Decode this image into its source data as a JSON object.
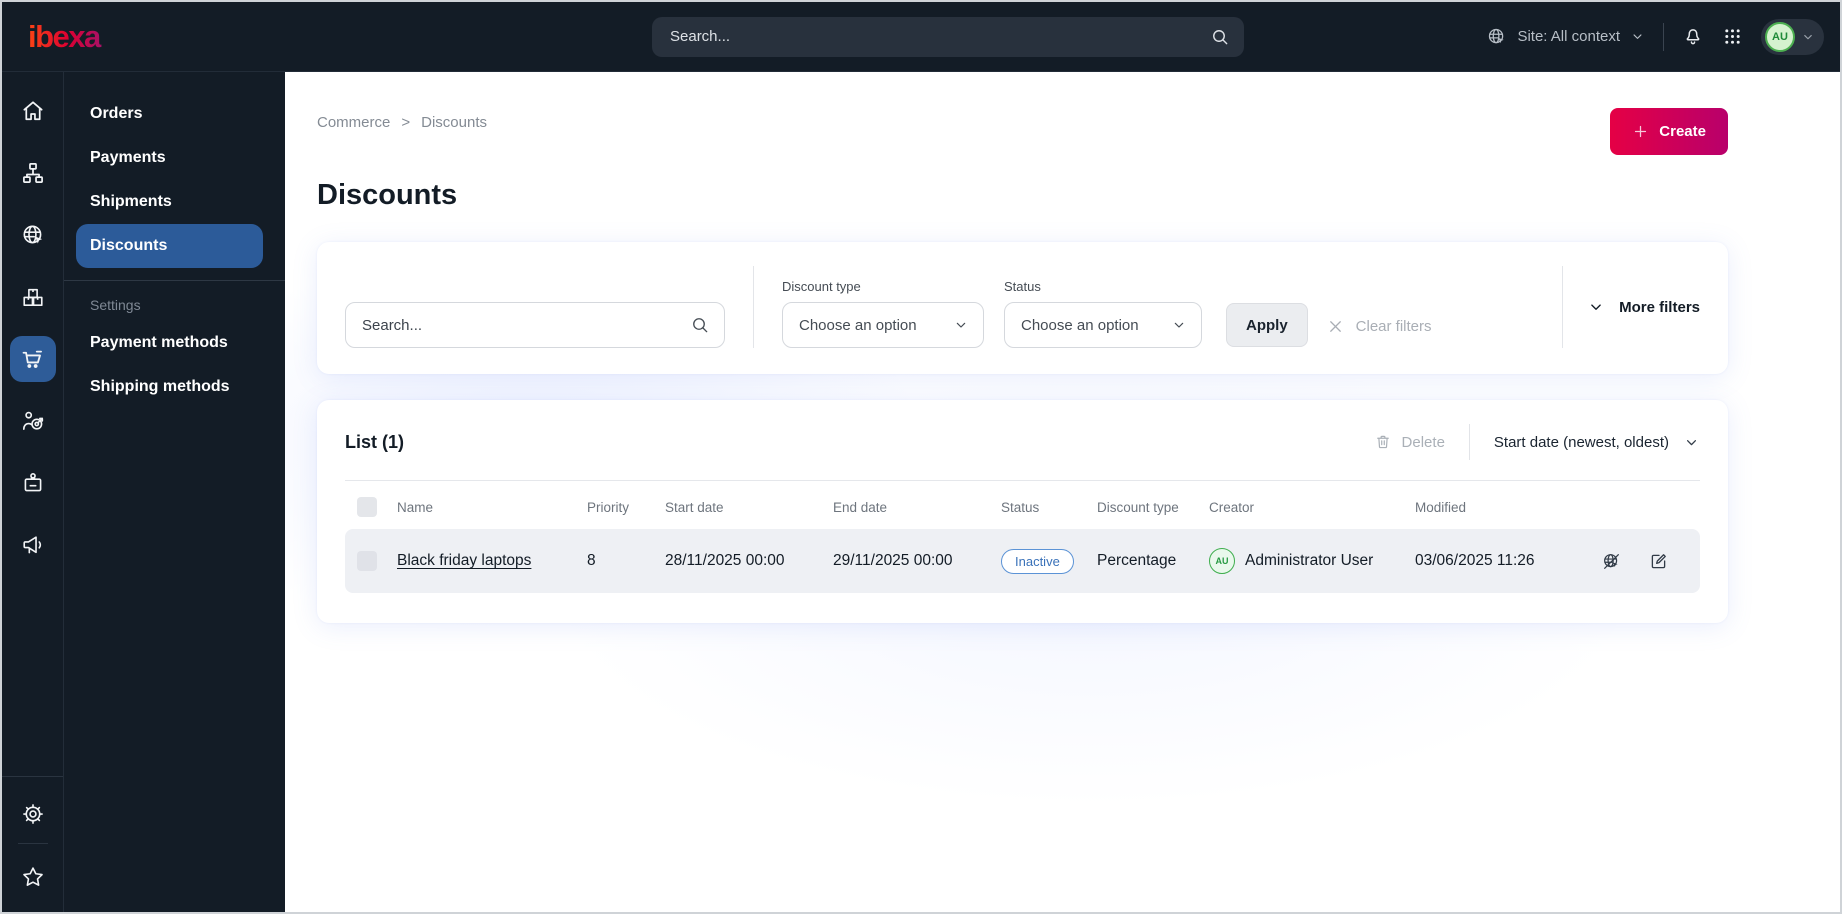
{
  "topbar": {
    "logo": "ibexa",
    "search_placeholder": "Search...",
    "site_label": "Site: All context",
    "icons": [
      "site-globe-icon",
      "bell-icon",
      "app-grid-icon",
      "chevron-down-icon"
    ]
  },
  "user": {
    "initials": "AU"
  },
  "rail": {
    "icons": [
      "home-icon",
      "content-tree-icon",
      "site-globe-cursor-icon",
      "products-boxes-icon",
      "commerce-cart-icon",
      "customer-target-icon",
      "company-badge-icon",
      "marketing-megaphone-icon"
    ],
    "active_index": 4,
    "bottom_icons": [
      "settings-gear-icon",
      "bookmarks-star-icon"
    ]
  },
  "panel": {
    "items": [
      {
        "label": "Orders",
        "active": false
      },
      {
        "label": "Payments",
        "active": false
      },
      {
        "label": "Shipments",
        "active": false
      },
      {
        "label": "Discounts",
        "active": true
      }
    ],
    "section_label": "Settings",
    "settings_items": [
      {
        "label": "Payment methods"
      },
      {
        "label": "Shipping methods"
      }
    ]
  },
  "breadcrumb": {
    "items": [
      "Commerce",
      "Discounts"
    ],
    "separator": ">"
  },
  "page": {
    "title": "Discounts",
    "create_label": "Create"
  },
  "filters": {
    "search_placeholder": "Search...",
    "discount_type_label": "Discount type",
    "discount_type_value": "Choose an option",
    "status_label": "Status",
    "status_value": "Choose an option",
    "apply_label": "Apply",
    "clear_label": "Clear filters",
    "more_label": "More filters"
  },
  "list": {
    "title": "List (1)",
    "delete_label": "Delete",
    "sort_label": "Start date (newest, oldest)",
    "columns": [
      "Name",
      "Priority",
      "Start date",
      "End date",
      "Status",
      "Discount type",
      "Creator",
      "Modified"
    ],
    "rows": [
      {
        "name": "Black friday laptops",
        "priority": "8",
        "start_date": "28/11/2025 00:00",
        "end_date": "29/11/2025 00:00",
        "status": "Inactive",
        "discount_type": "Percentage",
        "creator": "Administrator User",
        "creator_initials": "AU",
        "modified": "03/06/2025 11:26"
      }
    ],
    "row_action_icons": [
      "preview-disabled-icon",
      "edit-icon"
    ]
  },
  "colors": {
    "dark_bg": "#131c26",
    "active_blue": "#2c5b99",
    "create_gradient": [
      "#e50045",
      "#b8006b"
    ],
    "brand_gradient": [
      "#ff4713",
      "#db0032",
      "#a0146e"
    ],
    "status_inactive": "#3a72b9",
    "avatar_green": "#3fae4e",
    "row_bg": "#eef0f4"
  }
}
